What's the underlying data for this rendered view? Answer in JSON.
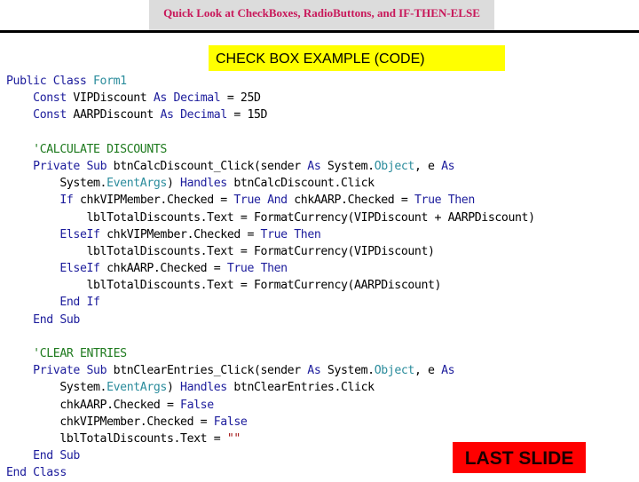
{
  "header": {
    "title": "Quick Look at CheckBoxes, RadioButtons, and IF-THEN-ELSE"
  },
  "section_title": "CHECK BOX EXAMPLE (CODE)",
  "colors": {
    "header_text": "#c8185a",
    "header_bg": "#dcdcdc",
    "section_bg": "#ffff00",
    "keyword": "#1c1c9c",
    "type": "#2b8c9c",
    "comment": "#1e7a1e",
    "string": "#a31515",
    "button_bg": "#ff0000"
  },
  "code": {
    "lines": [
      [
        {
          "t": "Public Class ",
          "c": "kw"
        },
        {
          "t": "Form1",
          "c": "ty"
        }
      ],
      [
        {
          "t": "    "
        },
        {
          "t": "Const",
          "c": "kw"
        },
        {
          "t": " VIPDiscount "
        },
        {
          "t": "As",
          "c": "kw"
        },
        {
          "t": " "
        },
        {
          "t": "Decimal",
          "c": "kw"
        },
        {
          "t": " = 25D"
        }
      ],
      [
        {
          "t": "    "
        },
        {
          "t": "Const",
          "c": "kw"
        },
        {
          "t": " AARPDiscount "
        },
        {
          "t": "As",
          "c": "kw"
        },
        {
          "t": " "
        },
        {
          "t": "Decimal",
          "c": "kw"
        },
        {
          "t": " = 15D"
        }
      ],
      [
        {
          "t": ""
        }
      ],
      [
        {
          "t": "    "
        },
        {
          "t": "'CALCULATE DISCOUNTS",
          "c": "cm"
        }
      ],
      [
        {
          "t": "    "
        },
        {
          "t": "Private Sub",
          "c": "kw"
        },
        {
          "t": " btnCalcDiscount_Click(sender "
        },
        {
          "t": "As",
          "c": "kw"
        },
        {
          "t": " System."
        },
        {
          "t": "Object",
          "c": "ty"
        },
        {
          "t": ", e "
        },
        {
          "t": "As",
          "c": "kw"
        }
      ],
      [
        {
          "t": "        System."
        },
        {
          "t": "EventArgs",
          "c": "ty"
        },
        {
          "t": ") "
        },
        {
          "t": "Handles",
          "c": "kw"
        },
        {
          "t": " btnCalcDiscount.Click"
        }
      ],
      [
        {
          "t": "        "
        },
        {
          "t": "If",
          "c": "kw"
        },
        {
          "t": " chkVIPMember.Checked = "
        },
        {
          "t": "True",
          "c": "kw"
        },
        {
          "t": " "
        },
        {
          "t": "And",
          "c": "kw"
        },
        {
          "t": " chkAARP.Checked = "
        },
        {
          "t": "True",
          "c": "kw"
        },
        {
          "t": " "
        },
        {
          "t": "Then",
          "c": "kw"
        }
      ],
      [
        {
          "t": "            lblTotalDiscounts.Text = FormatCurrency(VIPDiscount + AARPDiscount)"
        }
      ],
      [
        {
          "t": "        "
        },
        {
          "t": "ElseIf",
          "c": "kw"
        },
        {
          "t": " chkVIPMember.Checked = "
        },
        {
          "t": "True",
          "c": "kw"
        },
        {
          "t": " "
        },
        {
          "t": "Then",
          "c": "kw"
        }
      ],
      [
        {
          "t": "            lblTotalDiscounts.Text = FormatCurrency(VIPDiscount)"
        }
      ],
      [
        {
          "t": "        "
        },
        {
          "t": "ElseIf",
          "c": "kw"
        },
        {
          "t": " chkAARP.Checked = "
        },
        {
          "t": "True",
          "c": "kw"
        },
        {
          "t": " "
        },
        {
          "t": "Then",
          "c": "kw"
        }
      ],
      [
        {
          "t": "            lblTotalDiscounts.Text = FormatCurrency(AARPDiscount)"
        }
      ],
      [
        {
          "t": "        "
        },
        {
          "t": "End If",
          "c": "kw"
        }
      ],
      [
        {
          "t": "    "
        },
        {
          "t": "End Sub",
          "c": "kw"
        }
      ],
      [
        {
          "t": ""
        }
      ],
      [
        {
          "t": "    "
        },
        {
          "t": "'CLEAR ENTRIES",
          "c": "cm"
        }
      ],
      [
        {
          "t": "    "
        },
        {
          "t": "Private Sub",
          "c": "kw"
        },
        {
          "t": " btnClearEntries_Click(sender "
        },
        {
          "t": "As",
          "c": "kw"
        },
        {
          "t": " System."
        },
        {
          "t": "Object",
          "c": "ty"
        },
        {
          "t": ", e "
        },
        {
          "t": "As",
          "c": "kw"
        }
      ],
      [
        {
          "t": "        System."
        },
        {
          "t": "EventArgs",
          "c": "ty"
        },
        {
          "t": ") "
        },
        {
          "t": "Handles",
          "c": "kw"
        },
        {
          "t": " btnClearEntries.Click"
        }
      ],
      [
        {
          "t": "        chkAARP.Checked = "
        },
        {
          "t": "False",
          "c": "kw"
        }
      ],
      [
        {
          "t": "        chkVIPMember.Checked = "
        },
        {
          "t": "False",
          "c": "kw"
        }
      ],
      [
        {
          "t": "        lblTotalDiscounts.Text = "
        },
        {
          "t": "\"\"",
          "c": "st"
        }
      ],
      [
        {
          "t": "    "
        },
        {
          "t": "End Sub",
          "c": "kw"
        }
      ],
      [
        {
          "t": "End Class",
          "c": "kw"
        }
      ]
    ]
  },
  "last_slide_button": "LAST SLIDE"
}
